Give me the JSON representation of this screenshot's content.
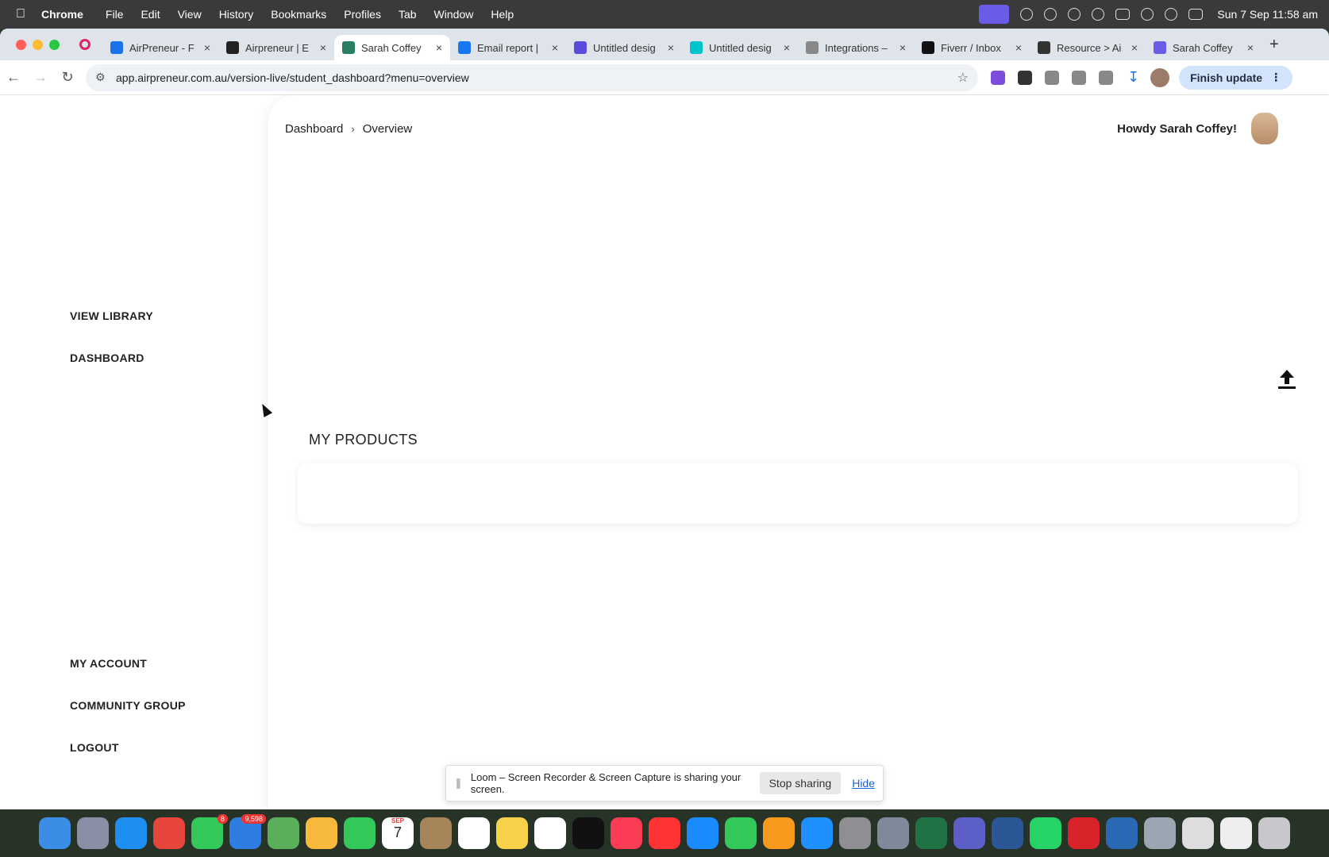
{
  "menubar": {
    "app": "Chrome",
    "items": [
      "File",
      "Edit",
      "View",
      "History",
      "Bookmarks",
      "Profiles",
      "Tab",
      "Window",
      "Help"
    ],
    "clock": "Sun 7 Sep  11:58 am"
  },
  "tabs": [
    {
      "title": "AirPreneur - F",
      "favicon": "airpreneur-icon",
      "color": "#1a73e8"
    },
    {
      "title": "Airpreneur | E",
      "favicon": "b-logo-icon",
      "color": "#222222"
    },
    {
      "title": "Sarah Coffey",
      "favicon": "signature-icon",
      "color": "#2a7f62",
      "active": true
    },
    {
      "title": "Email report |",
      "favicon": "facebook-icon",
      "color": "#1877f2"
    },
    {
      "title": "Untitled desig",
      "favicon": "design-icon",
      "color": "#5b4cdb"
    },
    {
      "title": "Untitled desig",
      "favicon": "canva-icon",
      "color": "#00c4cc"
    },
    {
      "title": "Integrations –",
      "favicon": "integrations-icon",
      "color": "#888888"
    },
    {
      "title": "Fiverr / Inbox",
      "favicon": "fiverr-icon",
      "color": "#111111"
    },
    {
      "title": "Resource > Ai",
      "favicon": "resource-icon",
      "color": "#333333"
    },
    {
      "title": "Sarah Coffey",
      "favicon": "gear-icon",
      "color": "#6b5ce7"
    }
  ],
  "toolbar": {
    "url": "app.airpreneur.com.au/version-live/student_dashboard?menu=overview",
    "finish_update": "Finish update"
  },
  "sidebar": {
    "view_library": "VIEW LIBRARY",
    "dashboard": "DASHBOARD",
    "my_account": "MY ACCOUNT",
    "community_group": "COMMUNITY GROUP",
    "logout": "LOGOUT"
  },
  "header": {
    "breadcrumb_root": "Dashboard",
    "breadcrumb_separator": "›",
    "breadcrumb_current": "Overview",
    "greeting": "Howdy Sarah Coffey!"
  },
  "main": {
    "products_title": "MY PRODUCTS"
  },
  "loom": {
    "message": "Loom – Screen Recorder & Screen Capture is sharing your screen.",
    "stop": "Stop sharing",
    "hide": "Hide"
  },
  "dock": {
    "messages_badge": "8",
    "mail_badge": "9,598",
    "calendar_day": "7",
    "calendar_month": "SEP"
  }
}
